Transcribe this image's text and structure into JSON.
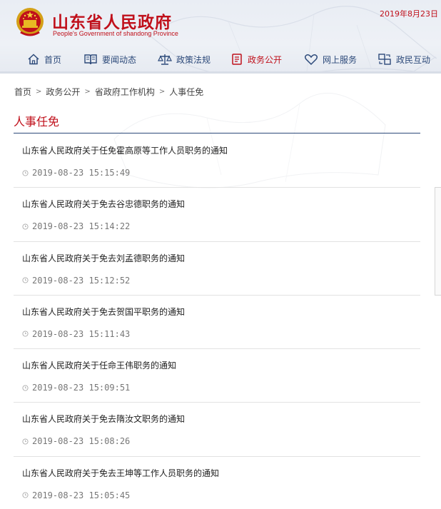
{
  "header": {
    "title": "山东省人民政府",
    "subtitle": "People's Government of shandong Province",
    "date": "2019年8月23日",
    "nav": [
      {
        "label": "首页",
        "icon": "home-icon"
      },
      {
        "label": "要闻动态",
        "icon": "book-icon"
      },
      {
        "label": "政策法规",
        "icon": "scales-icon"
      },
      {
        "label": "政务公开",
        "icon": "document-icon"
      },
      {
        "label": "网上服务",
        "icon": "heart-icon"
      },
      {
        "label": "政民互动",
        "icon": "interaction-icon"
      }
    ],
    "active_nav": "政务公开"
  },
  "breadcrumb": [
    "首页",
    "政务公开",
    "省政府工作机构",
    "人事任免"
  ],
  "section": {
    "title": "人事任免"
  },
  "articles": [
    {
      "title": "山东省人民政府关于任免霍高原等工作人员职务的通知",
      "time": "2019-08-23 15:15:49"
    },
    {
      "title": "山东省人民政府关于免去谷忠德职务的通知",
      "time": "2019-08-23 15:14:22"
    },
    {
      "title": "山东省人民政府关于免去刘孟德职务的通知",
      "time": "2019-08-23 15:12:52"
    },
    {
      "title": "山东省人民政府关于免去贺国平职务的通知",
      "time": "2019-08-23 15:11:43"
    },
    {
      "title": "山东省人民政府关于任命王伟职务的通知",
      "time": "2019-08-23 15:09:51"
    },
    {
      "title": "山东省人民政府关于免去隋汝文职务的通知",
      "time": "2019-08-23 15:08:26"
    },
    {
      "title": "山东省人民政府关于免去王坤等工作人员职务的通知",
      "time": "2019-08-23 15:05:45"
    }
  ],
  "colors": {
    "brand_red": "#c0101b",
    "nav_blue": "#2d4a7a"
  }
}
